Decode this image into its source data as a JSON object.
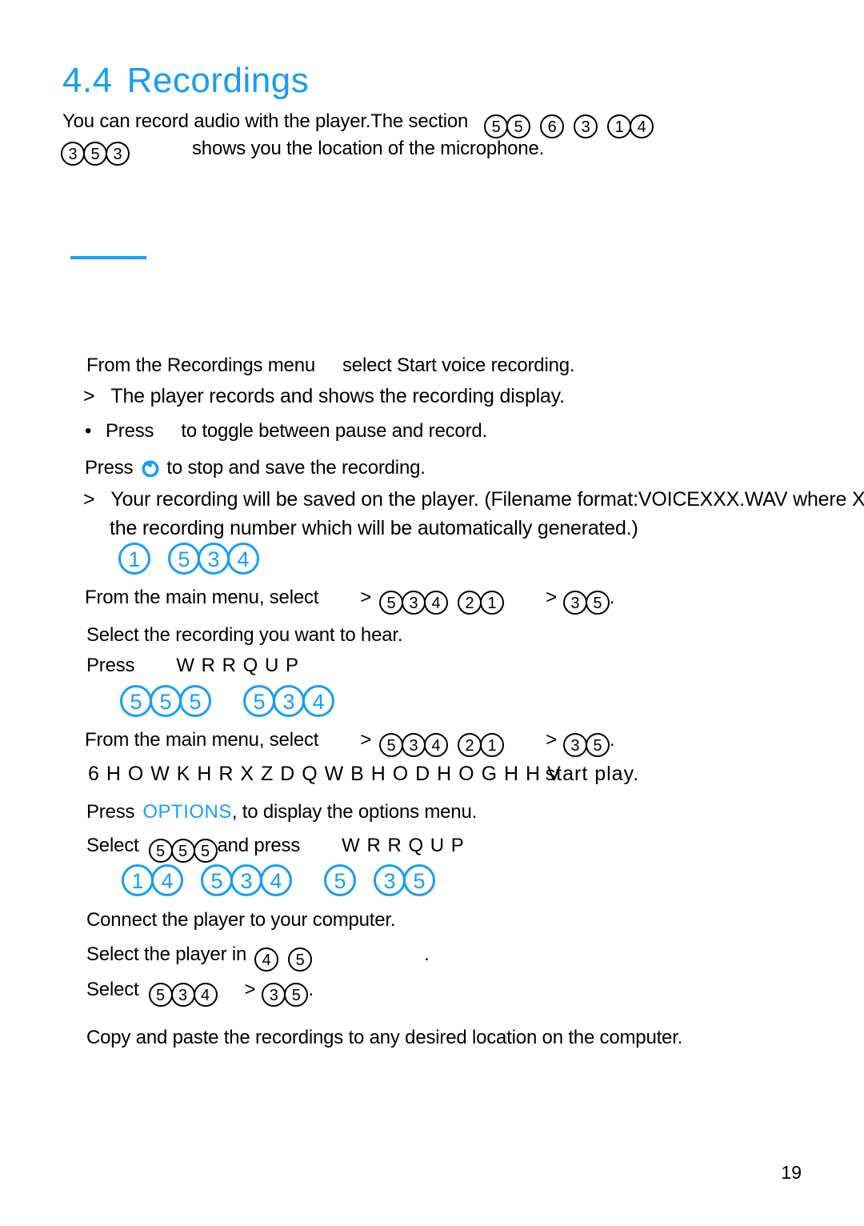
{
  "document": {
    "heading_number": "4.4",
    "heading_title": "Recordings",
    "page_number": "19"
  },
  "colors": {
    "accent_blue": "#179ef5",
    "text_black": "#000000",
    "page_background": "#ffffff"
  },
  "intro": {
    "line1_a": "You can record audio with the player.The section",
    "line1_tokens": [
      "5",
      "5",
      "6",
      "3",
      "1",
      "4"
    ],
    "line2_tokens": [
      "3",
      "5",
      "3"
    ],
    "line2_b": "shows you the location of the microphone."
  },
  "record_section": {
    "step_from_menu": "From the Recordings menu",
    "step_from_menu_2": "select Start voice recording.",
    "arrow": ">",
    "result_records": "The player records and shows the recording display.",
    "bullet": "•",
    "press_label": "Press",
    "toggle_text": "to toggle between pause and record.",
    "press_stop_a": "Press",
    "stop_icon": "stop-record-icon",
    "press_stop_b": "to stop and save the recording.",
    "saved_line1": "Your recording will be saved on the player. (Filename format:VOICEXXX.WAV where X",
    "saved_line2": "the recording number which will be automatically generated.)"
  },
  "playback_section": {
    "blue_tokens": [
      "1",
      "5",
      "3",
      "4"
    ],
    "from_main_menu": "From the main menu, select",
    "arrow": ">",
    "tokens_a": [
      "5",
      "3",
      "4"
    ],
    "tokens_b": [
      "2",
      "1"
    ],
    "tokens_c": [
      "3",
      "5"
    ],
    "period": ".",
    "select_recording": "Select the recording you want to hear.",
    "press_label": "Press",
    "press_garbled": "W R R Q  U P"
  },
  "delete_section": {
    "blue_tokens_a": [
      "5",
      "5",
      "5"
    ],
    "blue_tokens_b": [
      "5",
      "3",
      "4"
    ],
    "from_main_menu": "From the main menu, select",
    "arrow": ">",
    "tokens_a": [
      "5",
      "3",
      "4"
    ],
    "tokens_b": [
      "2",
      "1"
    ],
    "tokens_c": [
      "3",
      "5"
    ],
    "period": ".",
    "garbled_line": "6 H O W K H R X Z D Q W B H O D H O G H H V",
    "garbled_tail": "start play.",
    "press_options_a": "Press",
    "options_label": "OPTIONS",
    "press_options_b": ", to display the options menu.",
    "select_label": "Select",
    "select_tokens": [
      "5",
      "5",
      "5"
    ],
    "and_press": "and press",
    "and_press_garbled": "W R R Q  U P"
  },
  "transfer_section": {
    "blue_tokens_a": [
      "1",
      "4"
    ],
    "blue_tokens_b": [
      "5",
      "3",
      "4"
    ],
    "blue_tokens_c": [
      "5"
    ],
    "blue_tokens_d": [
      "3",
      "5"
    ],
    "connect_player": "Connect the player to your computer.",
    "select_player_in": "Select the player in",
    "select_player_tokens": [
      "4",
      "5"
    ],
    "select_player_period": ".",
    "select_label": "Select",
    "select_tokens_a": [
      "5",
      "3",
      "4"
    ],
    "arrow": ">",
    "select_tokens_b": [
      "3",
      "5"
    ],
    "select_period": ".",
    "copy_paste": "Copy and paste the recordings to any desired location on the computer."
  }
}
